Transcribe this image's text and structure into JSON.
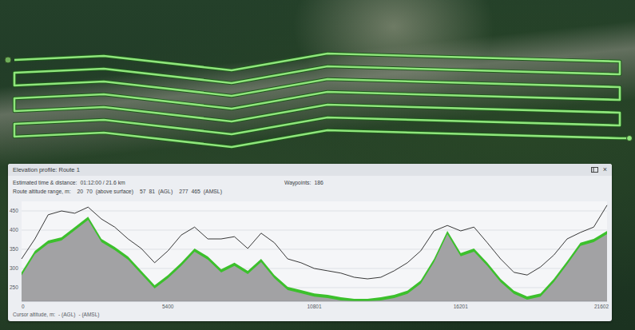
{
  "elevation_profile": {
    "title": "Elevation profile: Route 1",
    "close": "×",
    "estimate": {
      "label": "Estimated time & distance:",
      "value": "01:12:00 / 21.6 km"
    },
    "waypoints": {
      "label": "Waypoints:",
      "value": "186"
    },
    "altitude_range": {
      "label": "Route altitude range, m:",
      "groups": [
        {
          "min": "20",
          "max": "70",
          "unit": "(above surface)"
        },
        {
          "min": "57",
          "max": "81",
          "unit": "(AGL)"
        },
        {
          "min": "277",
          "max": "465",
          "unit": "(AMSL)"
        }
      ]
    },
    "chart": {
      "y_ticks": [
        "450",
        "400",
        "350",
        "300",
        "250"
      ],
      "x_ticks": [
        "0",
        "5400",
        "10801",
        "16201",
        "21602"
      ],
      "terrain": [
        290,
        346,
        373,
        381,
        408,
        435,
        377,
        356,
        331,
        294,
        256,
        283,
        315,
        352,
        331,
        298,
        315,
        294,
        325,
        283,
        252,
        244,
        235,
        231,
        225,
        221,
        221,
        225,
        231,
        242,
        269,
        325,
        398,
        340,
        352,
        315,
        273,
        242,
        227,
        235,
        273,
        319,
        367,
        377,
        398
      ],
      "route": [
        325,
        377,
        440,
        450,
        444,
        460,
        429,
        408,
        377,
        352,
        315,
        346,
        387,
        408,
        377,
        377,
        383,
        352,
        392,
        367,
        325,
        315,
        300,
        294,
        288,
        277,
        273,
        277,
        294,
        315,
        346,
        398,
        412,
        398,
        408,
        367,
        325,
        290,
        283,
        304,
        335,
        377,
        394,
        408,
        465
      ]
    },
    "cursor": {
      "label": "Cursor altitude, m:",
      "agl": "- (AGL)",
      "amsl": "- (AMSL)"
    }
  }
}
